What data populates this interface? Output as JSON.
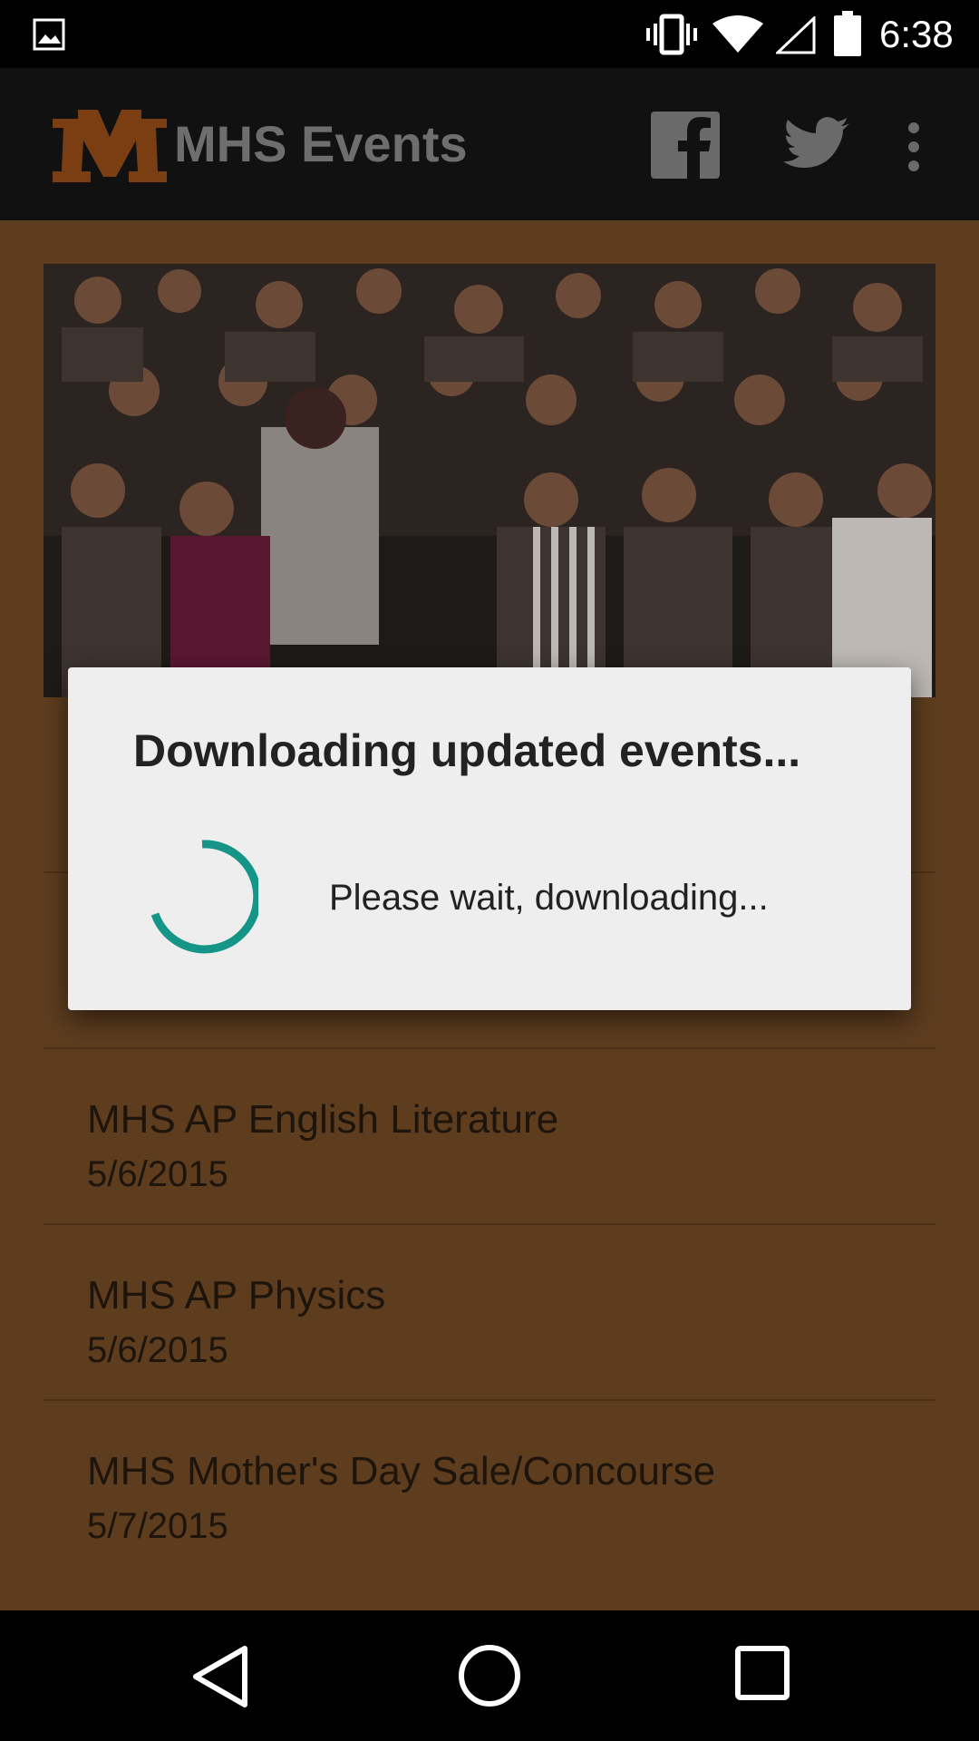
{
  "status_bar": {
    "time": "6:38",
    "icons": [
      "image-notification-icon",
      "vibrate-icon",
      "wifi-icon",
      "signal-icon",
      "battery-icon"
    ]
  },
  "app_bar": {
    "title": "MHS Events",
    "logo_icon": "mhs-m-logo",
    "action_icons": [
      "facebook-icon",
      "twitter-icon",
      "more-vert-icon"
    ],
    "colors": {
      "background": "#111111",
      "title": "#6e6e6e",
      "logo": "#7a3e12"
    }
  },
  "hero": {
    "description_icon": "crowd-photo"
  },
  "events": [
    {
      "title": "MHS AP English Literature",
      "date": "5/6/2015"
    },
    {
      "title": "MHS AP Physics",
      "date": "5/6/2015"
    },
    {
      "title": "MHS Mother's Day Sale/Concourse",
      "date": "5/7/2015"
    }
  ],
  "dialog": {
    "title": "Downloading updated events...",
    "message": "Please wait, downloading...",
    "spinner_color": "#159488"
  },
  "nav_bar": {
    "icons": [
      "back-icon",
      "home-icon",
      "recents-icon"
    ]
  },
  "colors": {
    "content_background": "#5e3d1f",
    "dialog_background": "#eeeeee"
  }
}
